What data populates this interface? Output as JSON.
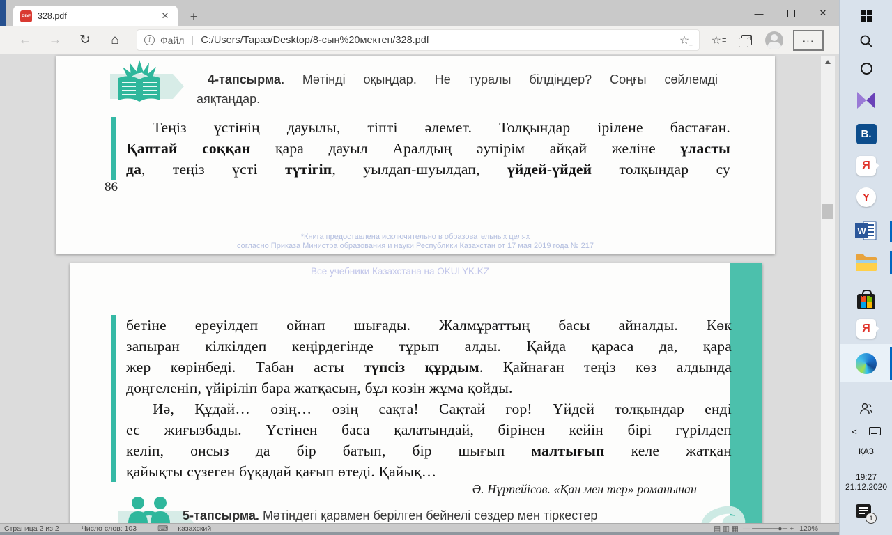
{
  "window": {
    "minimize_label": "—",
    "close_label": "✕"
  },
  "tab": {
    "title": "328.pdf",
    "pdf_badge": "PDF",
    "close": "✕",
    "new_tab": "+"
  },
  "toolbar": {
    "back": "←",
    "forward": "→",
    "refresh": "↻",
    "home": "⌂",
    "scheme_label": "Файл",
    "separator": "|",
    "url": "C:/Users/Тараз/Desktop/8-сын%20мектеп/328.pdf",
    "star": "☆",
    "star_plus": "+",
    "favbar_star": "☆",
    "favbar_lines": "≡",
    "more": "···"
  },
  "page1": {
    "task_label": "4-тапсырма.",
    "task_text": " Мәтінді оқыңдар. Не туралы білдіңдер? Соңғы сөйлемді",
    "task_text2": "аяқтаңдар.",
    "passage": [
      {
        "indent": true,
        "justify": true,
        "segs": [
          {
            "t": "Теңіз үстінің дауылы, тіпті әлемет. Толқындар ірілене бастаған.",
            "b": false
          }
        ]
      },
      {
        "indent": false,
        "justify": true,
        "segs": [
          {
            "t": "Қаптай соққан",
            "b": true
          },
          {
            "t": " қара дауыл Аралдың әупірім айқай желіне ",
            "b": false
          },
          {
            "t": "ұласты",
            "b": true
          }
        ]
      },
      {
        "indent": false,
        "justify": true,
        "segs": [
          {
            "t": "да",
            "b": true
          },
          {
            "t": ", теңіз үсті ",
            "b": false
          },
          {
            "t": "түтігіп",
            "b": true
          },
          {
            "t": ", уылдап-шуылдап, ",
            "b": false
          },
          {
            "t": "үйдей-үйдей",
            "b": true
          },
          {
            "t": " толқындар су",
            "b": false
          }
        ]
      }
    ],
    "page_number": "86",
    "watermark_line1": "*Книга предоставлена исключительно в образовательных целях",
    "watermark_line2": "согласно Приказа Министра образования и науки Республики Казахстан от 17 мая 2019 года № 217"
  },
  "page2": {
    "watermark": "Все учебники Казахстана на OKULYK.KZ",
    "passage": [
      {
        "indent": false,
        "justify": true,
        "segs": [
          {
            "t": "бетіне ереуілдеп ойнап шығады. Жалмұраттың басы айналды. Көк",
            "b": false
          }
        ]
      },
      {
        "indent": false,
        "justify": true,
        "segs": [
          {
            "t": "запыран кілкілдеп кеңірдегінде тұрып алды. Қайда қараса да, қара",
            "b": false
          }
        ]
      },
      {
        "indent": false,
        "justify": true,
        "segs": [
          {
            "t": "жер көрінбеді. Табан асты ",
            "b": false
          },
          {
            "t": "түпсіз құрдым",
            "b": true
          },
          {
            "t": ". Қайнаған теңіз көз алдында",
            "b": false
          }
        ]
      },
      {
        "indent": false,
        "justify": false,
        "segs": [
          {
            "t": "дөңгеленіп, үйіріліп бара жатқасын, бұл көзін жұма қойды.",
            "b": false
          }
        ]
      },
      {
        "indent": true,
        "justify": true,
        "segs": [
          {
            "t": "Иә, Құдай… өзің… өзің сақта! Сақтай гөр! Үйдей толқындар енді",
            "b": false
          }
        ]
      },
      {
        "indent": false,
        "justify": true,
        "segs": [
          {
            "t": "ес жиғызбады. Үстінен баса қалатындай, бірінен кейін бірі гүрілдеп",
            "b": false
          }
        ]
      },
      {
        "indent": false,
        "justify": true,
        "segs": [
          {
            "t": "келіп, онсыз да бір батып, бір шығып ",
            "b": false
          },
          {
            "t": "малтығып",
            "b": true
          },
          {
            "t": " келе жатқан",
            "b": false
          }
        ]
      },
      {
        "indent": false,
        "justify": false,
        "segs": [
          {
            "t": "қайықты сүзеген бұқадай қағып өтеді. Қайық…",
            "b": false
          }
        ]
      }
    ],
    "attribution": "Ә. Нұрпейісов. «Қан мен тер» романынан",
    "task_label": "5-тапсырма.",
    "task_text": " Мәтіндегі қарамен берілген бейнелі сөздер мен тіркестер"
  },
  "statusbar": {
    "page_info": "Страница 2 из 2",
    "word_count": "Число слов: 103",
    "language": "казахский",
    "zoom_level": "120%"
  },
  "taskbar": {
    "b_app_label": "B.",
    "yandex_letter": "Я",
    "y_browser_letter": "Y",
    "word_letter": "W",
    "chevron": "<",
    "language": "ҚАЗ",
    "time": "19:27",
    "date": "21.12.2020",
    "notification_badge": "1"
  },
  "colors": {
    "teal_accent": "#35b9a5",
    "teal_band": "#4cc0ac",
    "watermark_lavender": "#b3bedf",
    "taskbar_bg": "#d9e2ec",
    "run_indicator_blue": "#0067c0",
    "pdf_icon_red": "#d93a31"
  }
}
